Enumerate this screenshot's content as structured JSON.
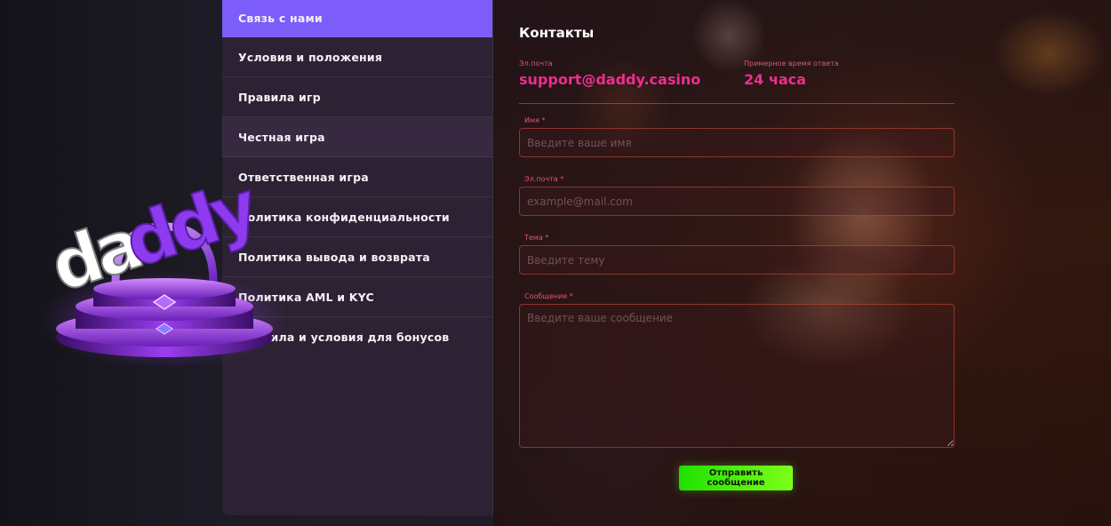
{
  "sidebar": {
    "items": [
      {
        "label": "Связь с нами"
      },
      {
        "label": "Условия и положения"
      },
      {
        "label": "Правила игр"
      },
      {
        "label": "Честная игра"
      },
      {
        "label": "Ответственная игра"
      },
      {
        "label": "Политика конфиденциальности"
      },
      {
        "label": "Политика вывода и возврата"
      },
      {
        "label": "Политика AML и KYC"
      },
      {
        "label": "Правила и условия для бонусов"
      }
    ]
  },
  "logo": {
    "text": "daddy",
    "colors": {
      "white": "#ffffff",
      "purple": "#8e3bf0"
    }
  },
  "contacts": {
    "title": "Контакты",
    "email_label": "Эл.почта",
    "email_value": "support@daddy.casino",
    "response_label": "Примерное время ответа",
    "response_value": "24 часа",
    "form": {
      "name_label": "Имя *",
      "name_placeholder": "Введите ваше имя",
      "email_label": "Эл.почта *",
      "email_placeholder": "example@mail.com",
      "subject_label": "Тема *",
      "subject_placeholder": "Введите тему",
      "message_label": "Сообщение *",
      "message_placeholder": "Введите ваше сообщение",
      "submit_label": "Отправить сообщение"
    }
  },
  "colors": {
    "accent": "#7c5df9",
    "pink": "#ef2d8e",
    "button_green": "#3ff000"
  }
}
